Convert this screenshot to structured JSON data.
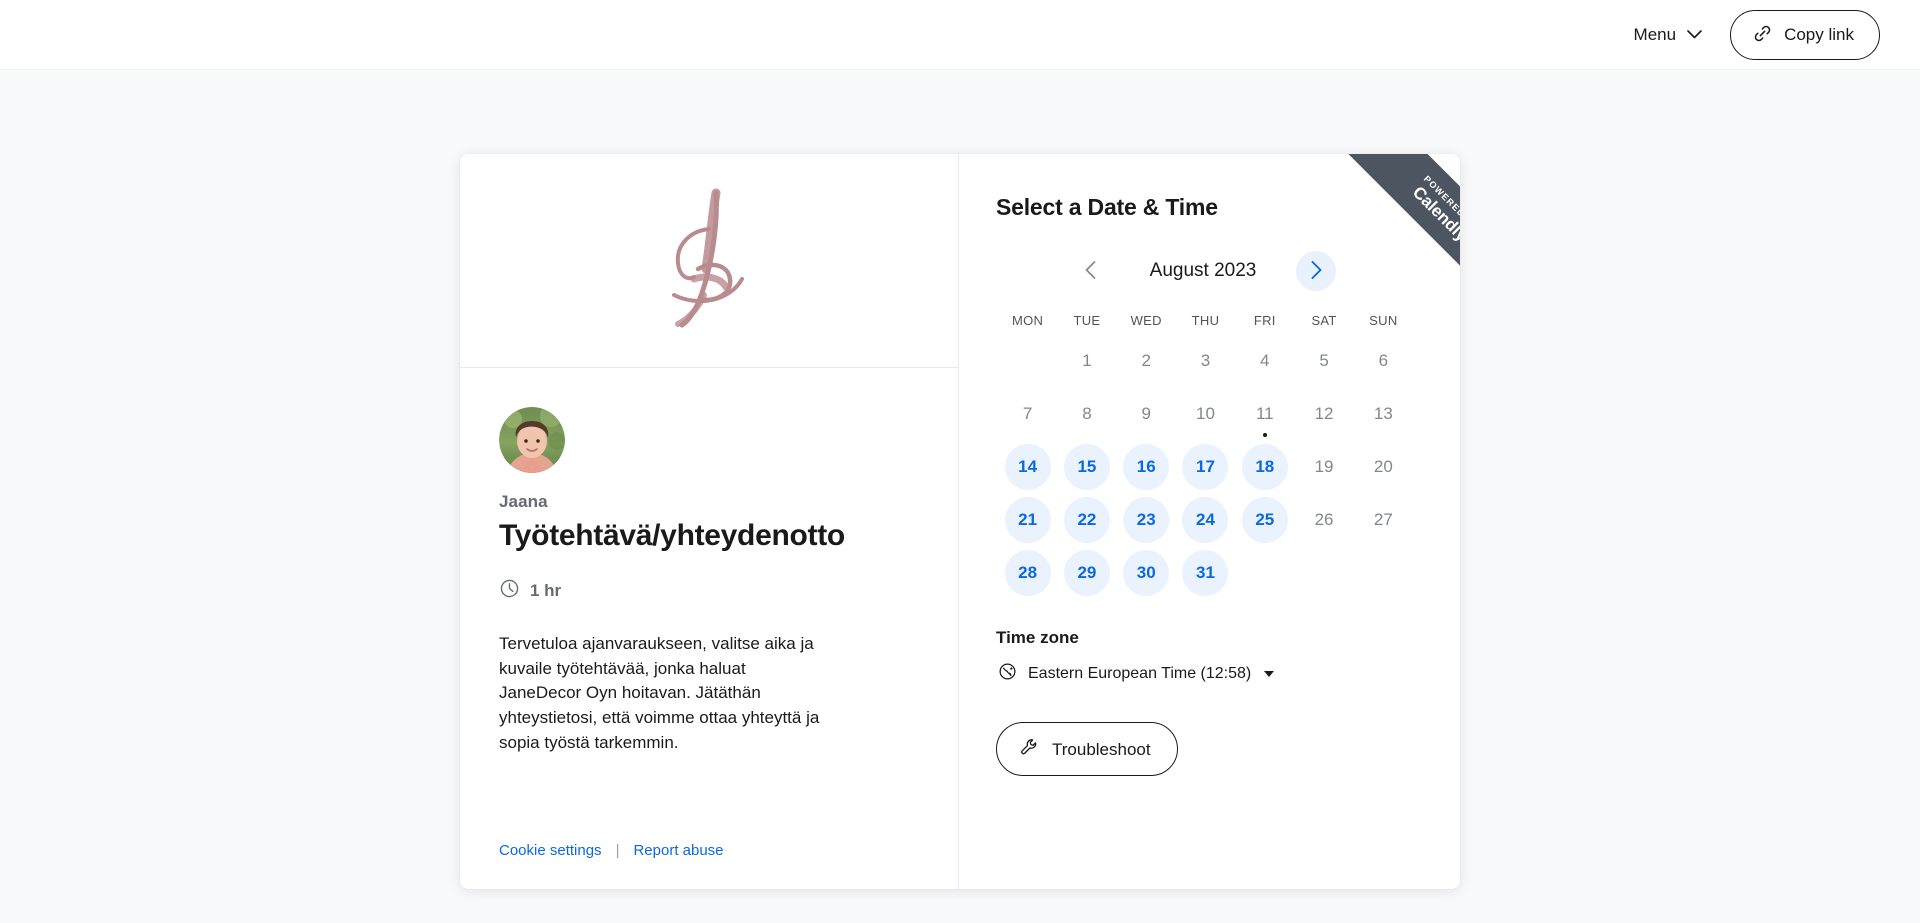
{
  "header": {
    "menu_label": "Menu",
    "menu_icon": "chevron-down-icon",
    "copy_link_label": "Copy link",
    "copy_link_icon": "link-icon"
  },
  "left_panel": {
    "logo_icon": "janedecor-brush-logo",
    "logo_color": "#b98a8e",
    "avatar_icon": "host-avatar-photo",
    "host_name": "Jaana",
    "event_title": "Työtehtävä/yhteydenotto",
    "duration_icon": "clock-icon",
    "duration": "1 hr",
    "description": "Tervetuloa ajanvaraukseen, valitse aika ja kuvaile työtehtävää, jonka haluat JaneDecor Oyn hoitavan. Jätäthän yhteystietosi, että voimme ottaa yhteyttä ja sopia työstä tarkemmin.",
    "footer": {
      "cookie_settings": "Cookie settings",
      "separator": "|",
      "report_abuse": "Report abuse"
    }
  },
  "right_panel": {
    "title": "Select a Date & Time",
    "prev_month_icon": "chevron-left-icon",
    "next_month_icon": "chevron-right-icon",
    "month_label": "August 2023",
    "weekdays": [
      "MON",
      "TUE",
      "WED",
      "THU",
      "FRI",
      "SAT",
      "SUN"
    ],
    "calendar": {
      "leading_blanks": 1,
      "days": [
        {
          "num": "1",
          "state": "disabled"
        },
        {
          "num": "2",
          "state": "disabled"
        },
        {
          "num": "3",
          "state": "disabled"
        },
        {
          "num": "4",
          "state": "disabled"
        },
        {
          "num": "5",
          "state": "disabled"
        },
        {
          "num": "6",
          "state": "disabled"
        },
        {
          "num": "7",
          "state": "disabled"
        },
        {
          "num": "8",
          "state": "disabled"
        },
        {
          "num": "9",
          "state": "disabled"
        },
        {
          "num": "10",
          "state": "disabled"
        },
        {
          "num": "11",
          "state": "disabled",
          "today": true
        },
        {
          "num": "12",
          "state": "disabled"
        },
        {
          "num": "13",
          "state": "disabled"
        },
        {
          "num": "14",
          "state": "available"
        },
        {
          "num": "15",
          "state": "available"
        },
        {
          "num": "16",
          "state": "available"
        },
        {
          "num": "17",
          "state": "available"
        },
        {
          "num": "18",
          "state": "available"
        },
        {
          "num": "19",
          "state": "disabled"
        },
        {
          "num": "20",
          "state": "disabled"
        },
        {
          "num": "21",
          "state": "available"
        },
        {
          "num": "22",
          "state": "available"
        },
        {
          "num": "23",
          "state": "available"
        },
        {
          "num": "24",
          "state": "available"
        },
        {
          "num": "25",
          "state": "available"
        },
        {
          "num": "26",
          "state": "disabled"
        },
        {
          "num": "27",
          "state": "disabled"
        },
        {
          "num": "28",
          "state": "available"
        },
        {
          "num": "29",
          "state": "available"
        },
        {
          "num": "30",
          "state": "available"
        },
        {
          "num": "31",
          "state": "available"
        }
      ]
    },
    "timezone": {
      "title": "Time zone",
      "icon": "globe-icon",
      "value": "Eastern European Time (12:58)"
    },
    "troubleshoot": {
      "label": "Troubleshoot",
      "icon": "wrench-icon"
    }
  },
  "ribbon": {
    "top_text": "POWERED BY",
    "brand": "Calendly",
    "color": "#4d5560"
  },
  "colors": {
    "accent_blue": "#0b69de",
    "available_bg": "#eaf2fe",
    "page_bg": "#f8f9fb",
    "text_primary": "#1a1a1a",
    "text_muted": "#666a73"
  }
}
